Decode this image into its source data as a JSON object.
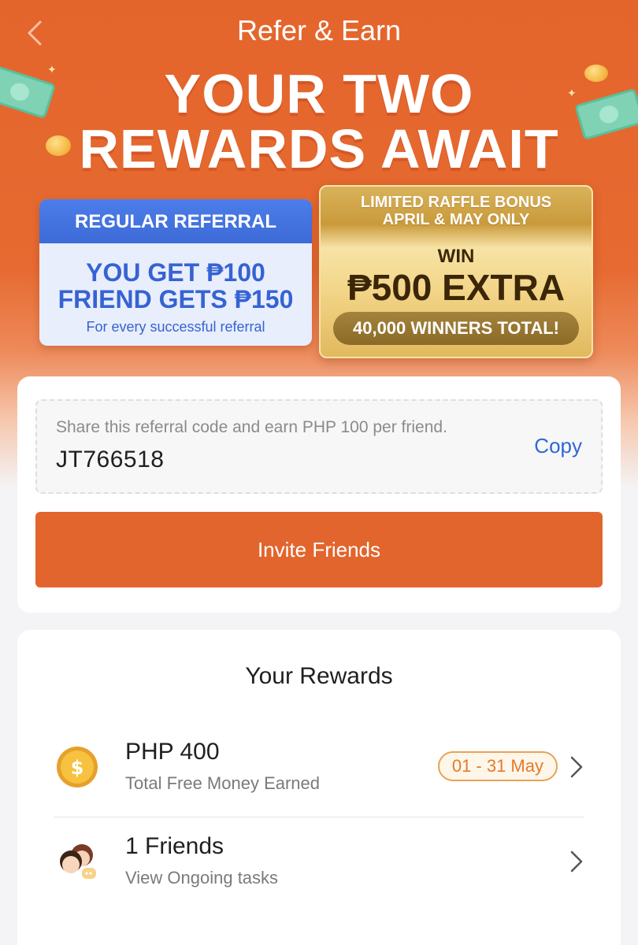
{
  "colors": {
    "primary_orange": "#e2652d",
    "link_blue": "#2f67d6",
    "regular_blue": "#3663d3",
    "gold": "#e1b95e"
  },
  "nav": {
    "title": "Refer & Earn",
    "back_icon": "chevron-left-icon"
  },
  "banner": {
    "headline_line1": "YOUR TWO",
    "headline_line2": "REWARDS AWAIT",
    "regular": {
      "header": "REGULAR REFERRAL",
      "line1": "YOU GET ₱100",
      "line2": "FRIEND GETS ₱150",
      "note": "For every successful referral"
    },
    "raffle": {
      "top_line1": "LIMITED RAFFLE BONUS",
      "top_line2": "APRIL & MAY ONLY",
      "win": "WIN",
      "amount": "₱500 EXTRA",
      "winners": "40,000 WINNERS TOTAL!"
    }
  },
  "share": {
    "hint": "Share this referral code and earn PHP 100 per friend.",
    "code": "JT766518",
    "copy_label": "Copy",
    "invite_label": "Invite Friends"
  },
  "rewards": {
    "title": "Your Rewards",
    "money": {
      "icon": "dollar-coin-icon",
      "amount": "PHP 400",
      "label": "Total Free Money Earned",
      "period": "01 - 31 May"
    },
    "friends": {
      "icon": "friends-avatar-icon",
      "count": "1 Friends",
      "label": "View Ongoing tasks"
    }
  }
}
